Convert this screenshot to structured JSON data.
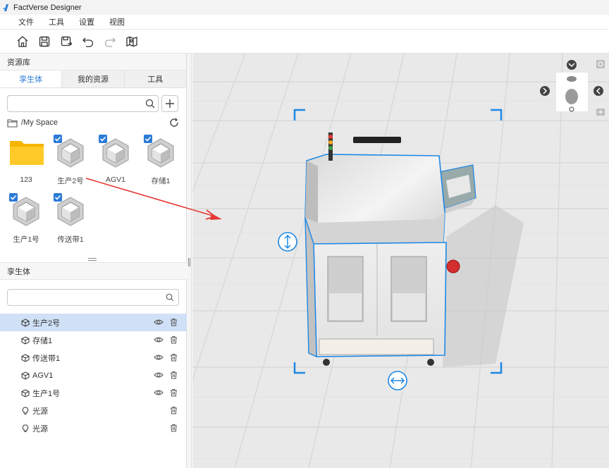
{
  "app": {
    "title": "FactVerse Designer"
  },
  "menu": [
    "文件",
    "工具",
    "设置",
    "视图"
  ],
  "toolbar": {
    "buttons": [
      {
        "name": "home-icon"
      },
      {
        "name": "save-icon"
      },
      {
        "name": "save-as-icon"
      },
      {
        "name": "undo-icon"
      },
      {
        "name": "redo-icon"
      },
      {
        "name": "map-icon"
      }
    ]
  },
  "library": {
    "header": "资源库",
    "tabs": [
      "孪生体",
      "我的资源",
      "工具"
    ],
    "active_tab": 0,
    "search_placeholder": "",
    "path": "/My Space",
    "assets": [
      {
        "label": "123",
        "type": "folder",
        "checked": false
      },
      {
        "label": "生产2号",
        "type": "model",
        "checked": true
      },
      {
        "label": "AGV1",
        "type": "model",
        "checked": true
      },
      {
        "label": "存储1",
        "type": "model",
        "checked": true
      },
      {
        "label": "生产1号",
        "type": "model",
        "checked": true
      },
      {
        "label": "传送带1",
        "type": "model",
        "checked": true
      }
    ]
  },
  "twins": {
    "header": "孪生体",
    "search_placeholder": "",
    "items": [
      {
        "label": "生产2号",
        "type": "twin",
        "selected": true,
        "visible_toggle": true
      },
      {
        "label": "存储1",
        "type": "twin",
        "selected": false,
        "visible_toggle": true
      },
      {
        "label": "传送带1",
        "type": "twin",
        "selected": false,
        "visible_toggle": true
      },
      {
        "label": "AGV1",
        "type": "twin",
        "selected": false,
        "visible_toggle": true
      },
      {
        "label": "生产1号",
        "type": "twin",
        "selected": false,
        "visible_toggle": true
      },
      {
        "label": "光源",
        "type": "light",
        "selected": false,
        "visible_toggle": false
      },
      {
        "label": "光源",
        "type": "light",
        "selected": false,
        "visible_toggle": false
      }
    ]
  },
  "colors": {
    "accent": "#2b7bd6",
    "selection": "#1e88e5",
    "selected_row": "#cfe0f7",
    "viewport_bg": "#e9e9e9",
    "arrow": "#e53935"
  }
}
